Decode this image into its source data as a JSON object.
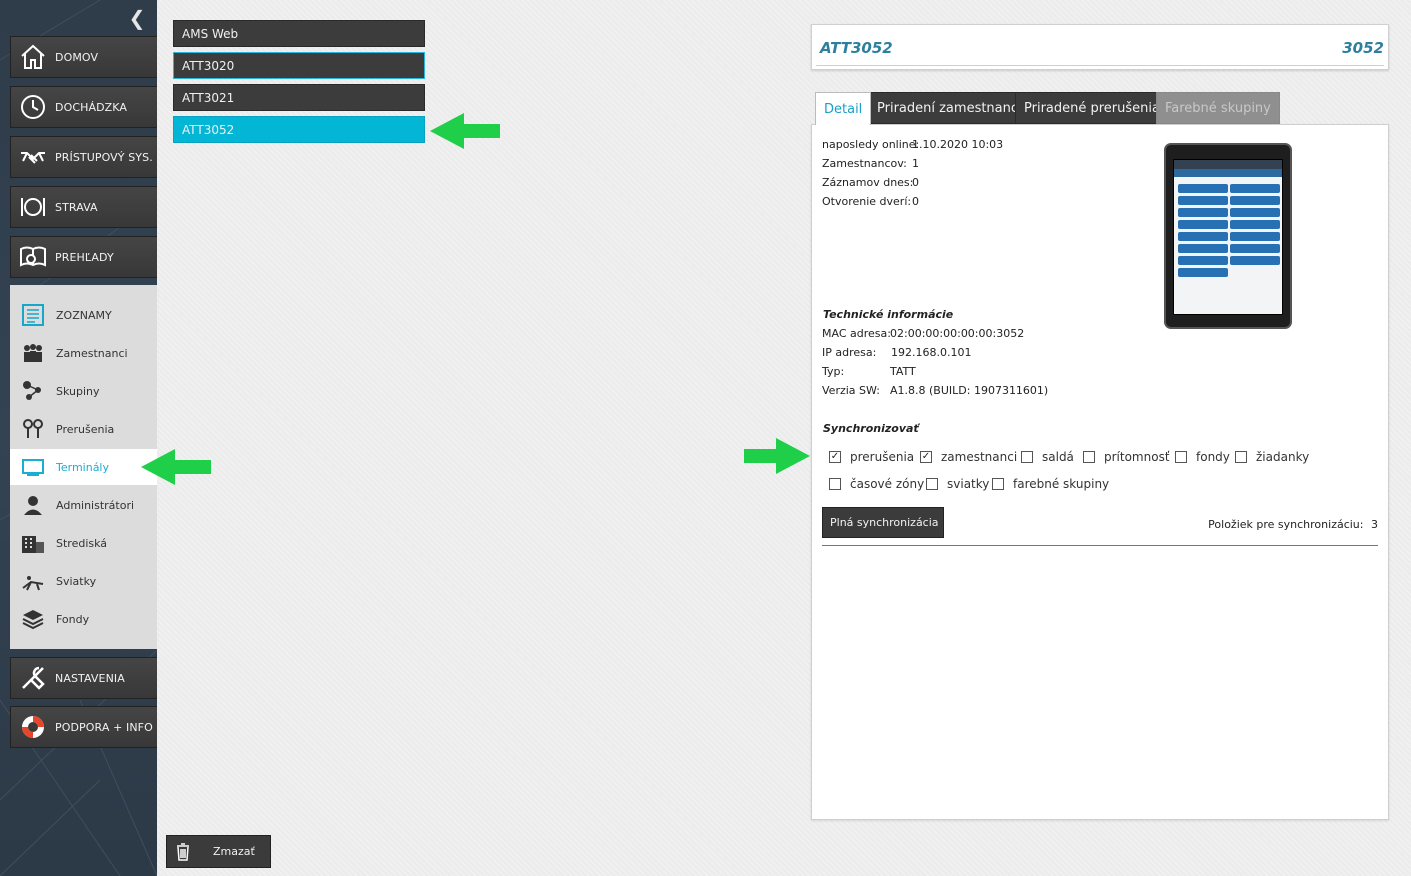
{
  "sidebar": {
    "main_nav": [
      {
        "label": "DOMOV",
        "icon": "house-icon"
      },
      {
        "label": "DOCHÁDZKA",
        "icon": "clock-icon"
      },
      {
        "label": "PRÍSTUPOVÝ SYS.",
        "icon": "handshake-icon"
      },
      {
        "label": "STRAVA",
        "icon": "plate-icon"
      },
      {
        "label": "PREHĽADY",
        "icon": "book-search-icon"
      }
    ],
    "sub_nav": [
      {
        "label": "ZOZNAMY",
        "icon": "list-icon"
      },
      {
        "label": "Zamestnanci",
        "icon": "people-icon"
      },
      {
        "label": "Skupiny",
        "icon": "group-icon"
      },
      {
        "label": "Prerušenia",
        "icon": "pins-icon"
      },
      {
        "label": "Terminály",
        "icon": "monitor-icon"
      },
      {
        "label": "Administrátori",
        "icon": "admin-icon"
      },
      {
        "label": "Strediská",
        "icon": "building-icon"
      },
      {
        "label": "Sviatky",
        "icon": "deckchair-icon"
      },
      {
        "label": "Fondy",
        "icon": "layers-icon"
      }
    ],
    "bottom_nav": [
      {
        "label": "NASTAVENIA",
        "icon": "tools-icon"
      },
      {
        "label": "PODPORA + INFO",
        "icon": "lifebuoy-icon"
      }
    ]
  },
  "terminals": [
    "AMS Web",
    "ATT3020",
    "ATT3021",
    "ATT3052"
  ],
  "delete_label": "Zmazať",
  "header": {
    "name": "ATT3052",
    "code": "3052"
  },
  "tabs": [
    "Detail",
    "Priradení zamestnanci",
    "Priradené prerušenia",
    "Farebné skupiny"
  ],
  "detail": {
    "rows": [
      {
        "label": "naposledy online:",
        "value": "1.10.2020 10:03"
      },
      {
        "label": "Zamestnancov:",
        "value": "1"
      },
      {
        "label": "Záznamov dnes:",
        "value": "0"
      },
      {
        "label": "Otvorenie dverí:",
        "value": "0"
      }
    ],
    "tech_title": "Technické informácie",
    "tech_rows": [
      {
        "label": "MAC adresa:",
        "value": "02:00:00:00:00:00:3052"
      },
      {
        "label": "IP adresa:",
        "value": "192.168.0.101"
      },
      {
        "label": "Typ:",
        "value": "TATT"
      },
      {
        "label": "Verzia SW:",
        "value": "A1.8.8 (BUILD: 1907311601)"
      }
    ],
    "sync_title": "Synchronizovať",
    "sync_options": [
      {
        "label": "prerušenia",
        "checked": true
      },
      {
        "label": "zamestnanci",
        "checked": true
      },
      {
        "label": "saldá",
        "checked": false
      },
      {
        "label": "prítomnosť",
        "checked": false
      },
      {
        "label": "fondy",
        "checked": false
      },
      {
        "label": "žiadanky",
        "checked": false
      },
      {
        "label": "časové zóny",
        "checked": false
      },
      {
        "label": "sviatky",
        "checked": false
      },
      {
        "label": "farebné skupiny",
        "checked": false
      }
    ],
    "full_sync_label": "Plná synchronizácia",
    "pending_label": "Položiek pre synchronizáciu:",
    "pending_count": "3"
  },
  "colors": {
    "accent": "#03b6d6",
    "arrow": "#1fcf4a",
    "title": "#2e7f9e"
  }
}
